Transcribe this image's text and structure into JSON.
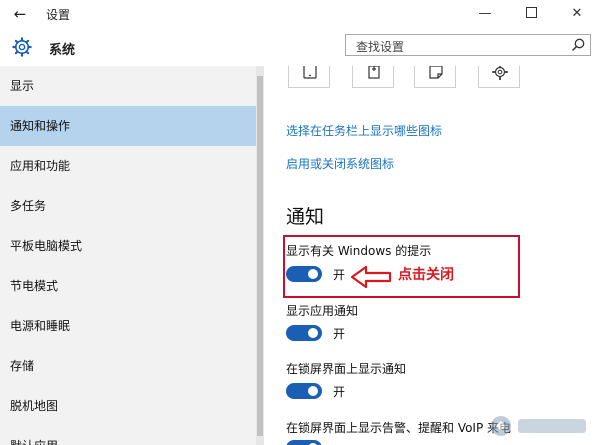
{
  "window": {
    "title": "设置",
    "back_glyph": "←",
    "minimize_glyph": "—",
    "close_glyph": "✕"
  },
  "header": {
    "app_title": "系统",
    "search_placeholder": "查找设置"
  },
  "sidebar": {
    "items": [
      {
        "label": "显示"
      },
      {
        "label": "通知和操作"
      },
      {
        "label": "应用和功能"
      },
      {
        "label": "多任务"
      },
      {
        "label": "平板电脑模式"
      },
      {
        "label": "节电模式"
      },
      {
        "label": "电源和睡眠"
      },
      {
        "label": "存储"
      },
      {
        "label": "脱机地图"
      },
      {
        "label": "默认应用"
      }
    ],
    "active_index": 1
  },
  "main": {
    "quick_action_icons": [
      "tablet-mode-icon",
      "connect-icon",
      "note-icon",
      "settings-icon"
    ],
    "links": [
      {
        "label": "选择在任务栏上显示哪些图标"
      },
      {
        "label": "启用或关闭系统图标"
      }
    ],
    "section_title": "通知",
    "settings": [
      {
        "label": "显示有关 Windows 的提示",
        "state_label": "开",
        "on": true
      },
      {
        "label": "显示应用通知",
        "state_label": "开",
        "on": true
      },
      {
        "label": "在锁屏界面上显示通知",
        "state_label": "开",
        "on": true
      },
      {
        "label": "在锁屏界面上显示告警、提醒和 VoIP 来电",
        "on": true
      }
    ]
  },
  "annotation": {
    "text": "点击关闭",
    "color": "#d9191f"
  },
  "colors": {
    "accent": "#1a5fb4",
    "link": "#1a73c1",
    "sidebar_active": "#b6d3ee",
    "highlight_border": "#c8102e"
  }
}
